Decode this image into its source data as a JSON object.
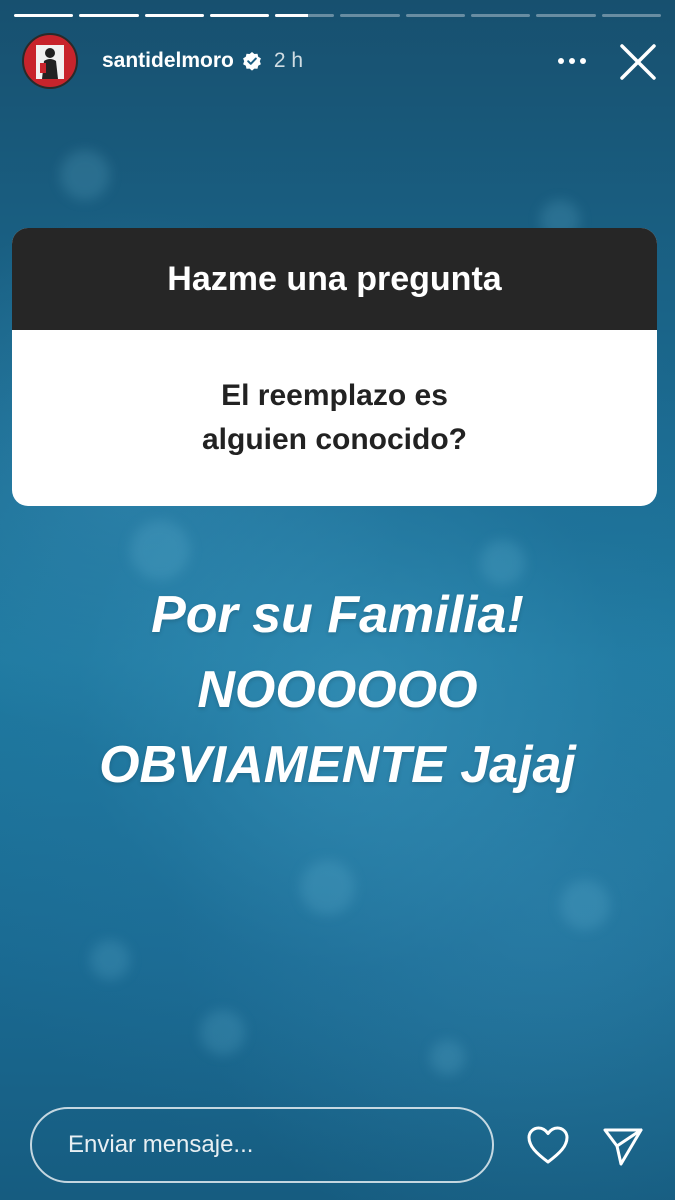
{
  "story": {
    "username": "santidelmoro",
    "time": "2 h",
    "segments": [
      1,
      1,
      1,
      1,
      0.55,
      0,
      0,
      0,
      0,
      0
    ],
    "avatar_color": "#c8242c"
  },
  "icons": {
    "verified": "verified-badge-icon",
    "more": "more-options-icon",
    "close": "close-icon",
    "heart": "heart-icon",
    "send": "send-icon"
  },
  "question_sticker": {
    "title": "Hazme una pregunta",
    "question_lines": [
      "El reemplazo es",
      "alguien conocido?"
    ]
  },
  "answer_lines": [
    "Por su Familia!",
    "NOOOOOO",
    "OBVIAMENTE Jajaj"
  ],
  "footer": {
    "message_placeholder": "Enviar mensaje..."
  }
}
